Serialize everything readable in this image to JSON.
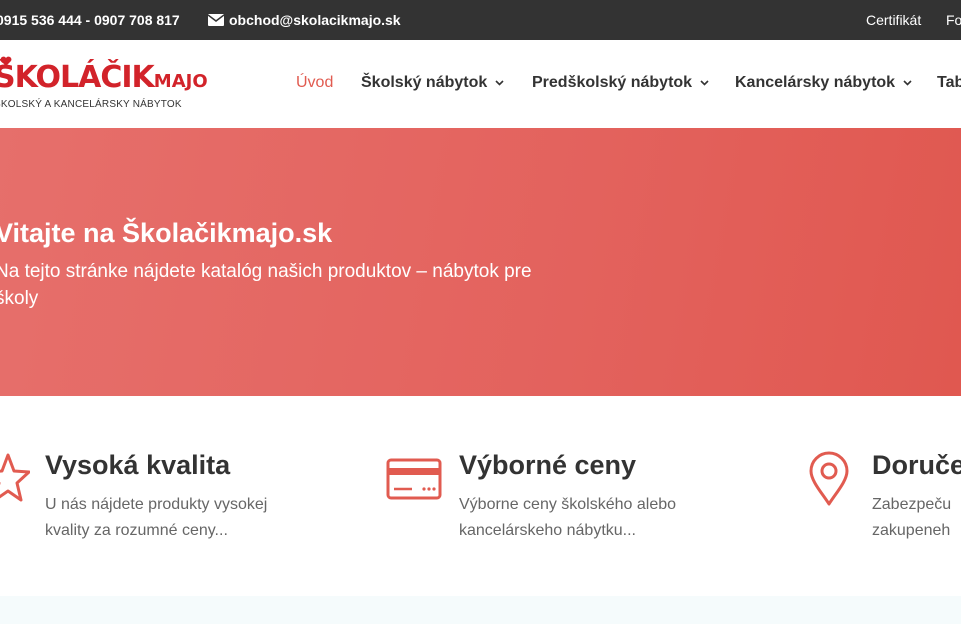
{
  "topbar": {
    "phone": "0915 536 444 - 0907 708 817",
    "email": "obchod@skolacikmajo.sk",
    "links": [
      "Certifikát",
      "Fo"
    ]
  },
  "logo": {
    "main_dark": "ŠKOLÁČIK",
    "main_red": "MAJO",
    "tagline": "ŠKOLSKÝ A KANCELÁRSKY NÁBYTOK"
  },
  "nav": {
    "items": [
      {
        "label": "Úvod",
        "active": true
      },
      {
        "label": "Školský nábytok",
        "active": false
      },
      {
        "label": "Predškolský nábytok",
        "active": false
      },
      {
        "label": "Kancelársky nábytok",
        "active": false
      },
      {
        "label": "Tab",
        "active": false
      }
    ]
  },
  "hero": {
    "title": "Vitajte na Školačikmajo.sk",
    "subtitle": "Na tejto stránke nájdete katalóg našich produktov – nábytok pre školy",
    "background": "#e3625d"
  },
  "features": [
    {
      "icon": "star-icon",
      "title": "Vysoká kvalita",
      "text": "U nás nájdete produkty vysokej kvality za rozumné ceny..."
    },
    {
      "icon": "credit-card-icon",
      "title": "Výborné ceny",
      "text": "Výborne ceny školského alebo kancelárskeho nábytku..."
    },
    {
      "icon": "location-pin-icon",
      "title": "Doruče",
      "text": "Zabezpeču zakupeneh"
    }
  ],
  "colors": {
    "accent": "#e15b50",
    "topbar": "#333333",
    "text": "#333333",
    "muted": "#666666"
  }
}
